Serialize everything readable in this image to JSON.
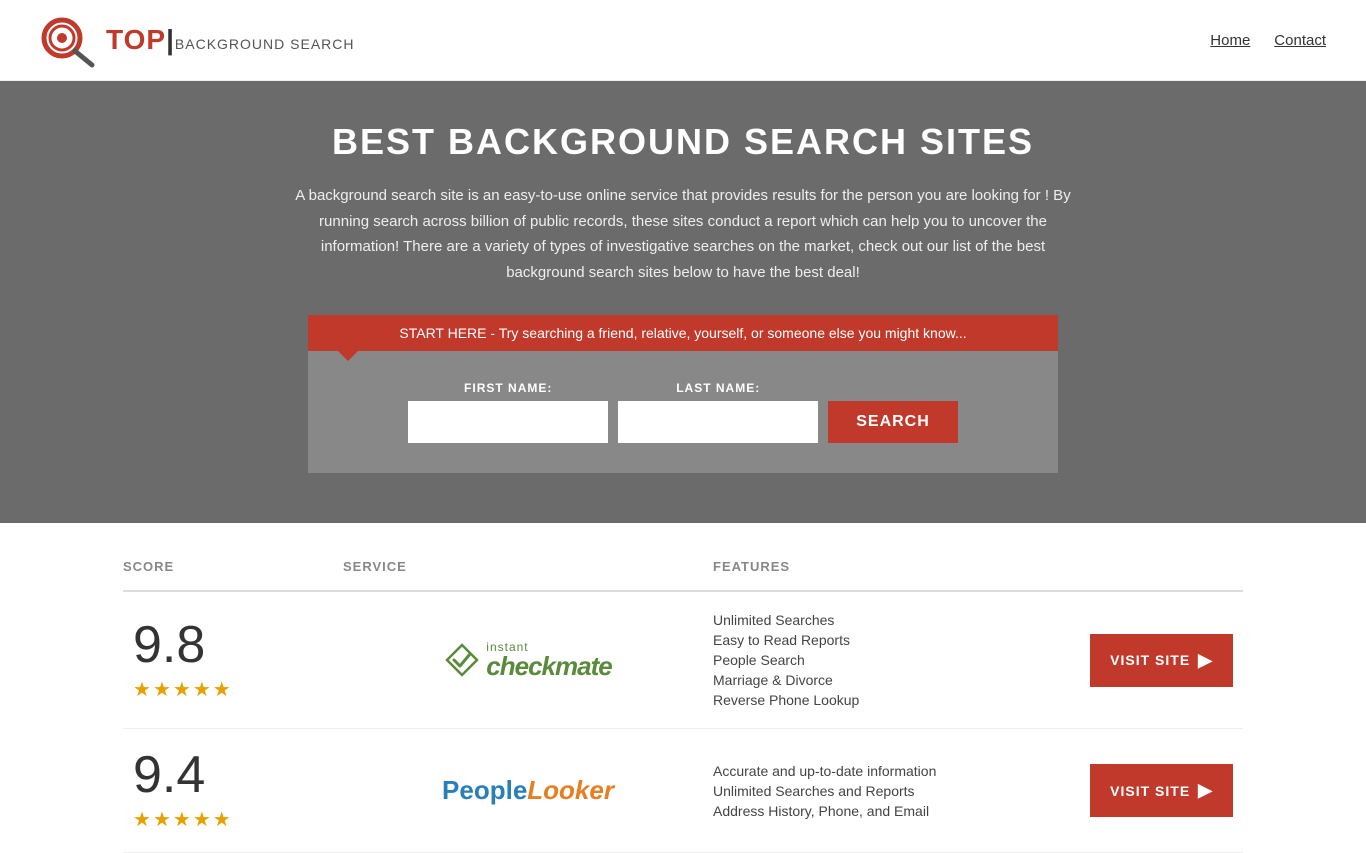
{
  "header": {
    "logo": {
      "top_text": "TOP",
      "sub_text": "BACKGROUND SEARCH"
    },
    "nav": {
      "home": "Home",
      "contact": "Contact"
    }
  },
  "hero": {
    "title": "BEST BACKGROUND SEARCH SITES",
    "description": "A background search site is an easy-to-use online service that provides results  for the person you are looking for ! By  running  search across billion of public records, these sites conduct  a report which can help you to uncover the information! There are a variety of types of investigative searches on the market, check out our  list of the best background search sites below to have the best deal!",
    "banner_text": "START HERE - Try searching a friend, relative, yourself, or someone else you might know...",
    "form": {
      "first_name_label": "FIRST NAME:",
      "last_name_label": "LAST NAME:",
      "search_button": "SEARCH"
    }
  },
  "table": {
    "headers": {
      "score": "SCORE",
      "service": "SERVICE",
      "features": "FEATURES",
      "action": ""
    },
    "rows": [
      {
        "score": "9.8",
        "stars": 4.5,
        "star_count": 5,
        "service_name": "Instant Checkmate",
        "features": [
          "Unlimited Searches",
          "Easy to Read Reports",
          "People Search",
          "Marriage & Divorce",
          "Reverse Phone Lookup"
        ],
        "visit_label": "VISIT SITE"
      },
      {
        "score": "9.4",
        "stars": 4.5,
        "star_count": 5,
        "service_name": "PeopleLooker",
        "features": [
          "Accurate and up-to-date information",
          "Unlimited Searches and Reports",
          "Address History, Phone, and Email"
        ],
        "visit_label": "VISIT SITE"
      }
    ]
  }
}
